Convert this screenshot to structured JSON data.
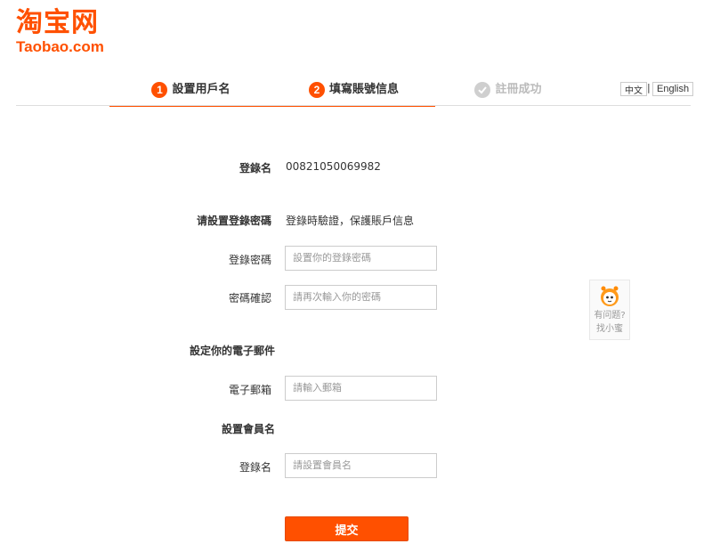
{
  "logo": {
    "chinese": "淘宝网",
    "english": "Taobao.com"
  },
  "steps": [
    {
      "number": "1",
      "label": "設置用戶名",
      "state": "done"
    },
    {
      "number": "2",
      "label": "填寫賬號信息",
      "state": "current"
    },
    {
      "number": "",
      "label": "註冊成功",
      "state": "pending"
    }
  ],
  "language": {
    "chinese": "中文",
    "separator": "|",
    "english": "English"
  },
  "form": {
    "login_name_label": "登錄名",
    "login_name_value": "00821050069982",
    "password_section_label": "请設置登錄密碼",
    "password_section_note": "登錄時驗證，保護賬戶信息",
    "password_label": "登錄密碼",
    "password_placeholder": "設置你的登錄密碼",
    "confirm_label": "密碼確認",
    "confirm_placeholder": "請再次輸入你的密碼",
    "email_section_title": "設定你的電子郵件",
    "email_label": "電子郵箱",
    "email_placeholder": "請輸入郵箱",
    "member_section_title": "設置會員名",
    "member_label": "登錄名",
    "member_placeholder": "請設置會員名",
    "submit_label": "提交"
  },
  "help": {
    "line1": "有问题?",
    "line2": "找小蜜"
  },
  "colors": {
    "accent": "#ff5000",
    "muted": "#cfcfcf"
  }
}
